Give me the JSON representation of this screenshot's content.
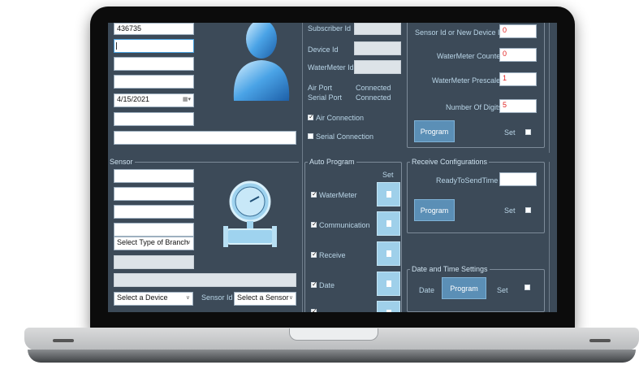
{
  "left_top": {
    "field1_value": "436735",
    "date_value": "4/15/2021",
    "date_icon": "calendar-dropdown-icon"
  },
  "sensor_group": {
    "title": "Sensor",
    "branch_placeholder": "Select Type of Branch",
    "device_select": "Select a Device",
    "sensor_id_label": "Sensor Id",
    "sensor_select": "Select a Sensor"
  },
  "device_info": {
    "subscriber_label": "Subscriber Id",
    "device_label": "Device Id",
    "watermeter_label": "WaterMeter Id",
    "air_port_label": "Air Port",
    "air_port_status": "Connected",
    "serial_port_label": "Serial Port",
    "serial_port_status": "Connected",
    "air_connection_label": "Air Connection",
    "serial_connection_label": "Serial Connection"
  },
  "meter_config": {
    "sensor_id_label": "Sensor Id or New Device Id",
    "sensor_id_value": "0",
    "counter_label": "WaterMeter Counter",
    "counter_value": "0",
    "prescaler_label": "WaterMeter Prescaler",
    "prescaler_value": "1",
    "digits_label": "Number Of Digits",
    "digits_value": "5",
    "program_label": "Program",
    "set_label": "Set"
  },
  "auto_program": {
    "title": "Auto Program",
    "set_header": "Set",
    "items": [
      {
        "label": "WaterMeter"
      },
      {
        "label": "Communication"
      },
      {
        "label": "Receive"
      },
      {
        "label": "Date"
      }
    ]
  },
  "receive_config": {
    "title": "Receive Configurations",
    "ready_label": "ReadyToSendTime",
    "program_label": "Program",
    "set_label": "Set"
  },
  "date_time": {
    "title": "Date and Time Settings",
    "date_label": "Date",
    "program_label": "Program",
    "set_label": "Set"
  },
  "colors": {
    "screen_bg": "#3c4a58",
    "accent_button": "#5b8fb6",
    "light_button": "#9fd0ea",
    "value_red": "#e02020"
  },
  "icons": {
    "person": "user-avatar-icon",
    "gauge": "water-gauge-icon"
  }
}
